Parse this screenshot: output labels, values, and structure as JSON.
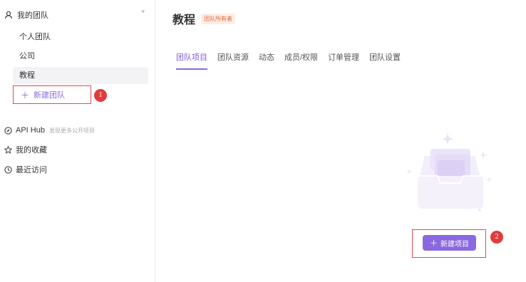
{
  "sidebar": {
    "team_header": "我的团队",
    "teams": [
      {
        "label": "个人团队"
      },
      {
        "label": "公司"
      },
      {
        "label": "教程"
      }
    ],
    "new_team_label": "新建团队",
    "annotation_1": "1",
    "api_hub": {
      "label": "API Hub",
      "sub": "发现更多公开项目"
    },
    "favorites": "我的收藏",
    "recent": "最近访问"
  },
  "main": {
    "title": "教程",
    "owner_tag": "团队所有者",
    "tabs": [
      {
        "label": "团队项目"
      },
      {
        "label": "团队资源"
      },
      {
        "label": "动态"
      },
      {
        "label": "成员/权限"
      },
      {
        "label": "订单管理"
      },
      {
        "label": "团队设置"
      }
    ],
    "new_project_label": "新建项目",
    "annotation_2": "2"
  },
  "colors": {
    "accent": "#8a68e0",
    "annotation": "#e23b3b"
  }
}
